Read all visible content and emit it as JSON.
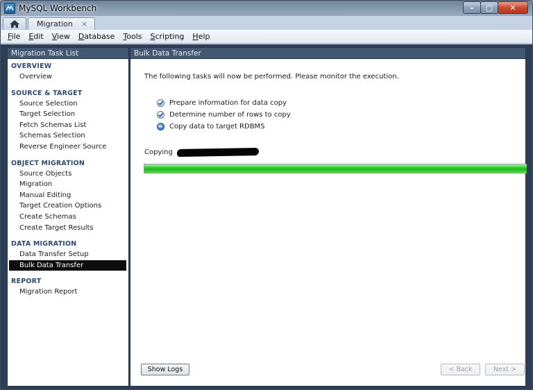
{
  "window": {
    "title": "MySQL Workbench",
    "controls": {
      "minimize": "–",
      "maximize": "▢",
      "close": "✕"
    }
  },
  "tabs": {
    "home_icon": "home-icon",
    "active": {
      "label": "Migration",
      "close": "×"
    }
  },
  "menu": [
    {
      "label": "File",
      "mnemonic": "F",
      "rest": "ile"
    },
    {
      "label": "Edit",
      "mnemonic": "E",
      "rest": "dit"
    },
    {
      "label": "View",
      "mnemonic": "V",
      "rest": "iew"
    },
    {
      "label": "Database",
      "mnemonic": "D",
      "rest": "atabase"
    },
    {
      "label": "Tools",
      "mnemonic": "T",
      "rest": "ools"
    },
    {
      "label": "Scripting",
      "mnemonic": "S",
      "rest": "cripting"
    },
    {
      "label": "Help",
      "mnemonic": "H",
      "rest": "elp"
    }
  ],
  "sidebar": {
    "header": "Migration Task List",
    "sections": [
      {
        "title": "OVERVIEW",
        "items": [
          "Overview"
        ]
      },
      {
        "title": "SOURCE & TARGET",
        "items": [
          "Source Selection",
          "Target Selection",
          "Fetch Schemas List",
          "Schemas Selection",
          "Reverse Engineer Source"
        ]
      },
      {
        "title": "OBJECT MIGRATION",
        "items": [
          "Source Objects",
          "Migration",
          "Manual Editing",
          "Target Creation Options",
          "Create Schemas",
          "Create Target Results"
        ]
      },
      {
        "title": "DATA MIGRATION",
        "items": [
          "Data Transfer Setup",
          "Bulk Data Transfer"
        ]
      },
      {
        "title": "REPORT",
        "items": [
          "Migration Report"
        ]
      }
    ],
    "selected": "Bulk Data Transfer"
  },
  "main": {
    "header": "Bulk Data Transfer",
    "intro": "The following tasks will now be performed. Please monitor the execution.",
    "tasks": [
      {
        "label": "Prepare information for data copy",
        "status": "done"
      },
      {
        "label": "Determine number of rows to copy",
        "status": "done"
      },
      {
        "label": "Copy data to target RDBMS",
        "status": "running"
      }
    ],
    "copying_label": "Copying",
    "progress": 1.0,
    "buttons": {
      "show_logs": "Show Logs",
      "back": "< Back",
      "next": "Next >"
    }
  },
  "colors": {
    "accent_green": "#1fb81a",
    "selected_bg": "#0d0d0d",
    "section_title": "#2e4a72",
    "frame_dark": "#2d3f57"
  }
}
